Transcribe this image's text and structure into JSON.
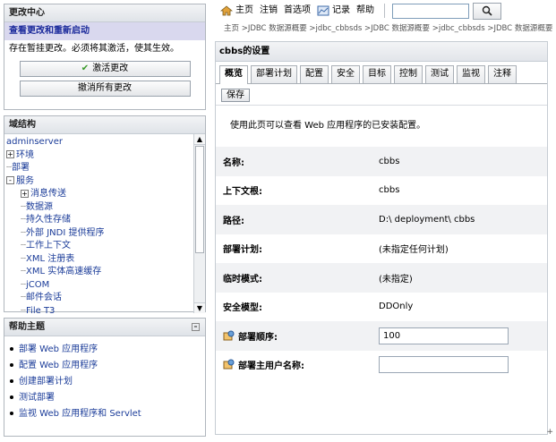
{
  "change_center": {
    "header": "更改中心",
    "title": "查看更改和重新启动",
    "message": "存在暂挂更改。必须将其激活，使其生效。",
    "activate_label": "激活更改",
    "undo_label": "撤消所有更改"
  },
  "domain_structure": {
    "header": "域结构",
    "root": "adminserver",
    "items": [
      {
        "label": "环境",
        "indent": 0,
        "expander": "+"
      },
      {
        "label": "部署",
        "indent": 0,
        "expander": ""
      },
      {
        "label": "服务",
        "indent": 0,
        "expander": "-"
      },
      {
        "label": "消息传送",
        "indent": 1,
        "expander": "+"
      },
      {
        "label": "数据源",
        "indent": 1,
        "expander": ""
      },
      {
        "label": "持久性存储",
        "indent": 1,
        "expander": ""
      },
      {
        "label": "外部 JNDI 提供程序",
        "indent": 1,
        "expander": ""
      },
      {
        "label": "工作上下文",
        "indent": 1,
        "expander": ""
      },
      {
        "label": "XML 注册表",
        "indent": 1,
        "expander": ""
      },
      {
        "label": "XML 实体高速缓存",
        "indent": 1,
        "expander": ""
      },
      {
        "label": "jCOM",
        "indent": 1,
        "expander": ""
      },
      {
        "label": "邮件会话",
        "indent": 1,
        "expander": ""
      },
      {
        "label": "File T3",
        "indent": 1,
        "expander": ""
      }
    ]
  },
  "help": {
    "header": "帮助主题",
    "items": [
      "部署 Web 应用程序",
      "配置 Web 应用程序",
      "创建部署计划",
      "测试部署",
      "监视 Web 应用程序和 Servlet"
    ]
  },
  "toolbar": {
    "home": "主页",
    "logout": "注销",
    "prefs": "首选项",
    "record": "记录",
    "help": "帮助"
  },
  "breadcrumb": "主页 >JDBC 数据源概要 >jdbc_cbbsds >JDBC 数据源概要 >jdbc_cbbsds >JDBC 数据源概要",
  "content": {
    "title": "cbbs的设置",
    "tabs": [
      "概览",
      "部署计划",
      "配置",
      "安全",
      "目标",
      "控制",
      "测试",
      "监视",
      "注释"
    ],
    "save_label": "保存",
    "description": "使用此页可以查看 Web 应用程序的已安装配置。",
    "fields": [
      {
        "label": "名称:",
        "value": "cbbs"
      },
      {
        "label": "上下文根:",
        "value": "cbbs"
      },
      {
        "label": "路径:",
        "value": "D:\\ deployment\\ cbbs"
      },
      {
        "label": "部署计划:",
        "value": "(未指定任何计划)"
      },
      {
        "label": "临时模式:",
        "value": "(未指定)"
      },
      {
        "label": "安全模型:",
        "value": "DDOnly"
      },
      {
        "label": "部署顺序:",
        "value": "100"
      },
      {
        "label": "部署主用户名称:",
        "value": ""
      }
    ]
  },
  "colors": {
    "link": "#1b3c99",
    "change_title_bg": "#d9d8ee",
    "change_title_text": "#1b2a9b"
  }
}
